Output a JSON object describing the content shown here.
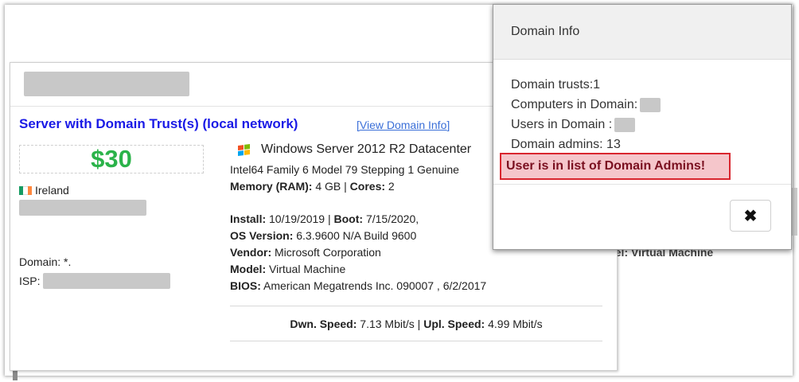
{
  "server": {
    "title": "Server with Domain Trust(s) (local network)",
    "view_link": "[View Domain Info]",
    "price": "$30",
    "country": "Ireland",
    "domain_label": "Domain: *.",
    "isp_label": "ISP:",
    "os": "Windows Server 2012 R2 Datacenter",
    "cpu": "Intel64 Family 6 Model 79 Stepping 1 Genuine",
    "memory_label": "Memory (RAM):",
    "memory_value": "4 GB",
    "cores_label": "Cores:",
    "cores_value": "2",
    "install_label": "Install:",
    "install_value": "10/19/2019",
    "boot_label": "Boot:",
    "boot_value": "7/15/2020,",
    "osver_label": "OS Version:",
    "osver_value": "6.3.9600 N/A Build 9600",
    "vendor_label": "Vendor:",
    "vendor_value": "Microsoft Corporation",
    "model_label": "Model:",
    "model_value": "Virtual Machine",
    "bios_label": "BIOS:",
    "bios_value": "American Megatrends Inc. 090007 , 6/2/2017",
    "dwn_label": "Dwn. Speed:",
    "dwn_value": "7.13 Mbit/s",
    "upl_label": "Upl. Speed:",
    "upl_value": "4.99 Mbit/s",
    "separator": "|"
  },
  "background": {
    "right_text": "Model: Virtual Machine"
  },
  "modal": {
    "title": "Domain Info",
    "trusts": "Domain trusts:1",
    "computers": "Computers in Domain:",
    "users": "Users in Domain :",
    "admins": "Domain admins: 13",
    "alert": "User is in list of Domain Admins!",
    "close_glyph": "✖"
  },
  "colors": {
    "title_blue": "#1a1ae6",
    "price_green": "#2bb34a",
    "alert_bg": "#f5c6cb",
    "alert_border": "#d9262f"
  },
  "icons": {
    "flag": "ireland-flag-icon",
    "os": "windows-logo-icon",
    "close": "close-icon"
  }
}
